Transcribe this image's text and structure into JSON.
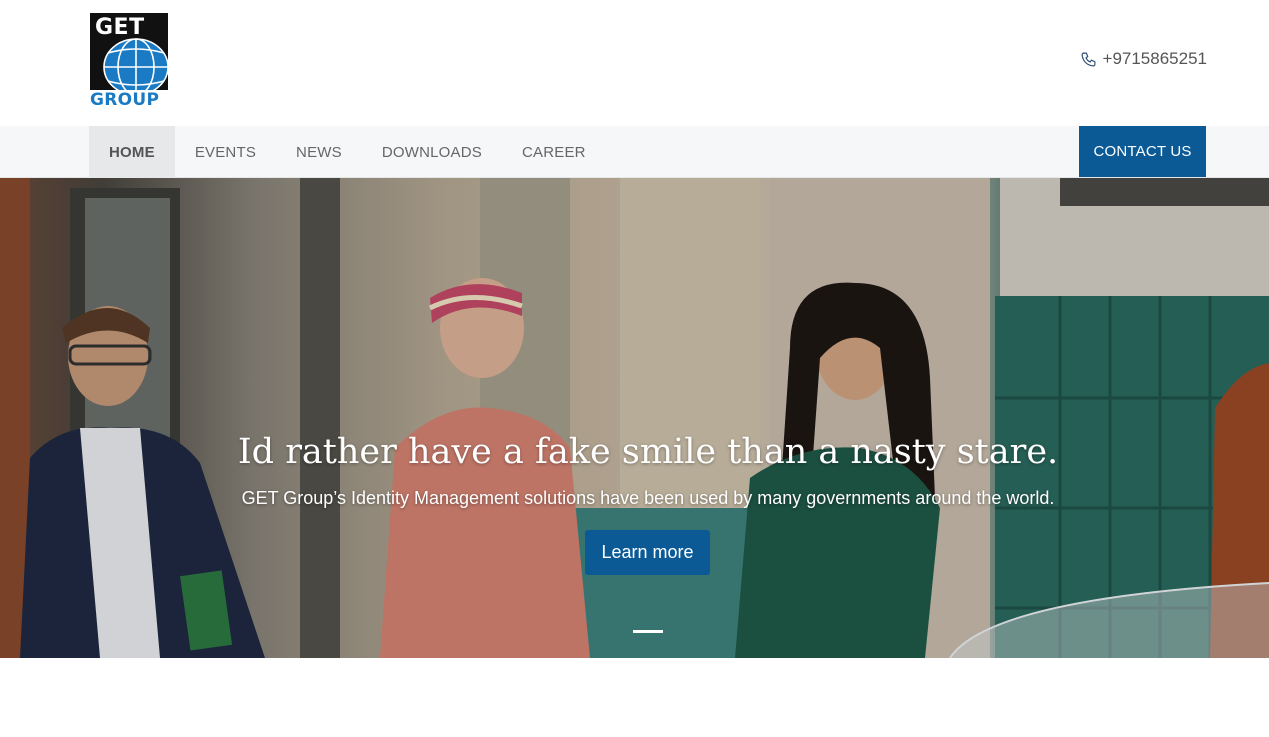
{
  "header": {
    "logo": {
      "top_text": "GET",
      "bottom_text": "GROUP",
      "globe_color": "#1a7bc4"
    },
    "phone": {
      "icon": "phone-icon",
      "number": "+9715865251"
    }
  },
  "nav": {
    "items": [
      {
        "label": "HOME",
        "active": true
      },
      {
        "label": "EVENTS",
        "active": false
      },
      {
        "label": "NEWS",
        "active": false
      },
      {
        "label": "DOWNLOADS",
        "active": false
      },
      {
        "label": "CAREER",
        "active": false
      }
    ],
    "contact_label": "CONTACT US"
  },
  "hero": {
    "title": "Id rather have a fake smile than a nasty stare.",
    "subtitle": "GET Group’s Identity Management solutions have been used by many governments around the world.",
    "button_label": "Learn more",
    "slide_count": 1,
    "active_slide": 0
  },
  "colors": {
    "brand": "#0b5a96",
    "nav_bg": "#f6f7f8"
  }
}
